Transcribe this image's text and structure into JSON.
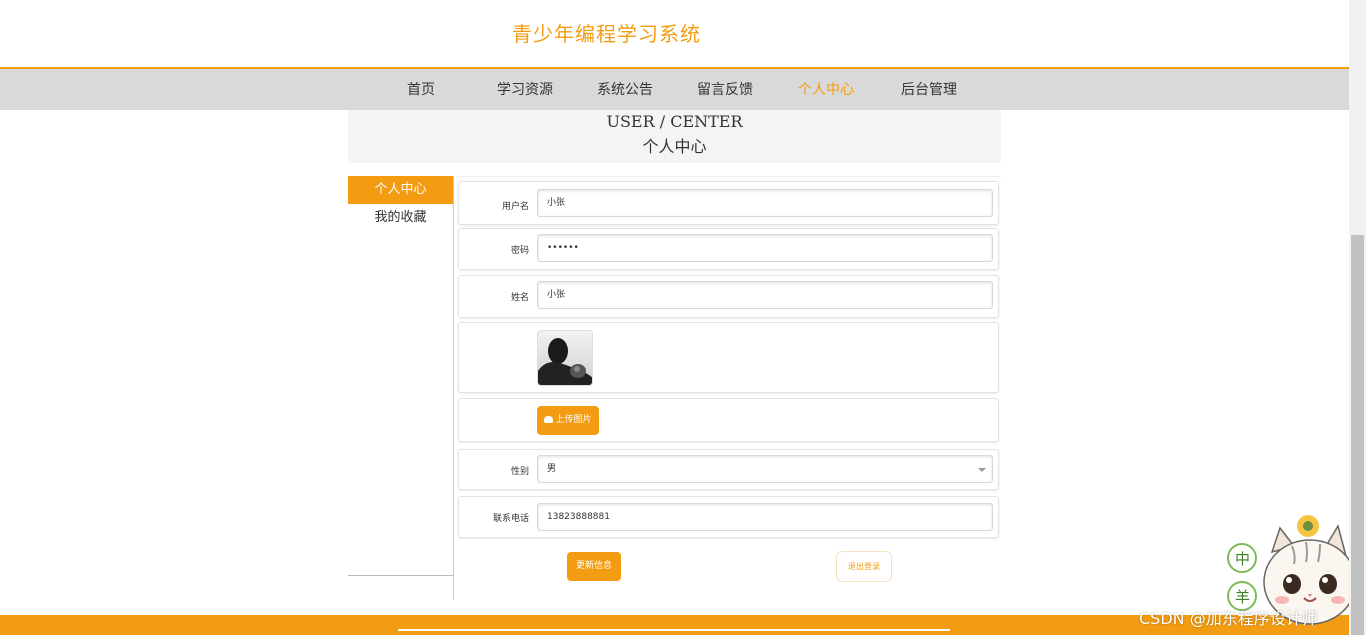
{
  "header": {
    "title": "青少年编程学习系统"
  },
  "nav": {
    "items": [
      {
        "label": "首页"
      },
      {
        "label": "学习资源"
      },
      {
        "label": "系统公告"
      },
      {
        "label": "留言反馈"
      },
      {
        "label": "个人中心",
        "active": true
      },
      {
        "label": "后台管理"
      }
    ]
  },
  "section": {
    "title_en": "USER / CENTER",
    "title_cn": "个人中心"
  },
  "side_menu": {
    "items": [
      {
        "label": "个人中心",
        "active": true
      },
      {
        "label": "我的收藏"
      }
    ]
  },
  "form": {
    "username": {
      "label": "用户名",
      "value": "小张"
    },
    "password": {
      "label": "密码",
      "value": "••••••"
    },
    "name": {
      "label": "姓名",
      "value": "小张"
    },
    "upload_label": "上传图片",
    "gender": {
      "label": "性别",
      "value": "男"
    },
    "phone": {
      "label": "联系电话",
      "value": "13823888881"
    },
    "update_label": "更新信息",
    "logout_label": "退出登录"
  },
  "watermark": "CSDN @加东程序设计师",
  "colors": {
    "accent": "#f39c12",
    "nav_bg": "#d9d9d9",
    "footer": "#f39c12"
  }
}
